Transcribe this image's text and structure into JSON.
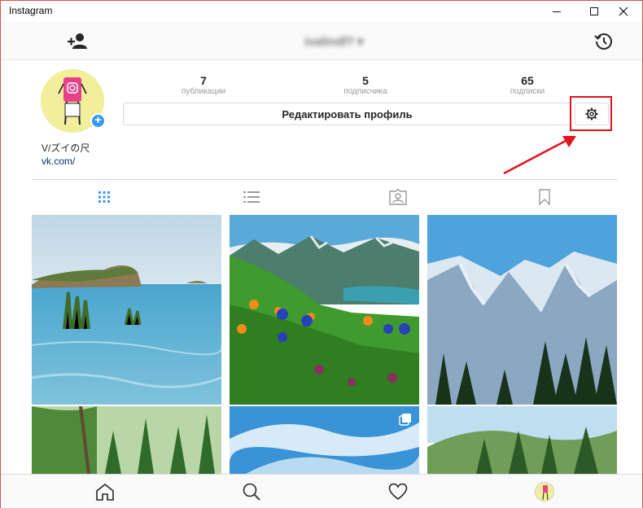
{
  "window": {
    "title": "Instagram"
  },
  "header": {
    "username": "ivalindf7 ▾"
  },
  "profile": {
    "stats": [
      {
        "count": "7",
        "label": "публикации"
      },
      {
        "count": "5",
        "label": "подписчика"
      },
      {
        "count": "65",
        "label": "подписки"
      }
    ],
    "edit_label": "Редактировать профиль",
    "display_name": "V/ズイの尺",
    "website": "vk.com/"
  },
  "colors": {
    "accent": "#3897f0",
    "highlight": "#e0141e",
    "link": "#003569"
  },
  "tabs": [
    "grid-icon",
    "list-icon",
    "tagged-icon",
    "saved-icon"
  ],
  "nav": [
    "home-icon",
    "search-icon",
    "heart-icon",
    "profile-avatar"
  ]
}
